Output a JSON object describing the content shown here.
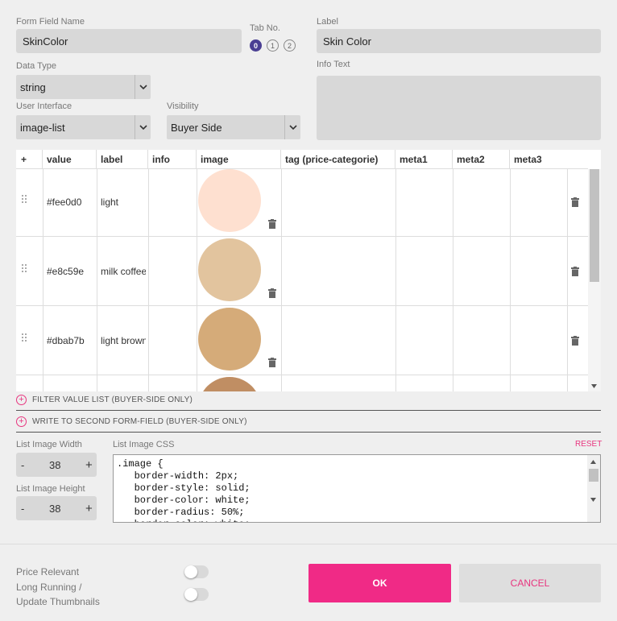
{
  "form": {
    "field_name_label": "Form Field Name",
    "field_name_value": "SkinColor",
    "tab_no_label": "Tab No.",
    "tabs": [
      "0",
      "1",
      "2"
    ],
    "label_label": "Label",
    "label_value": "Skin Color",
    "data_type_label": "Data Type",
    "data_type_value": "string",
    "info_text_label": "Info Text",
    "info_text_value": "",
    "ui_label": "User Interface",
    "ui_value": "image-list",
    "visibility_label": "Visibility",
    "visibility_value": "Buyer Side"
  },
  "table": {
    "add": "+",
    "headers": [
      "value",
      "label",
      "info",
      "image",
      "tag (price-categorie)",
      "meta1",
      "meta2",
      "meta3"
    ],
    "rows": [
      {
        "value": "#fee0d0",
        "label": "light",
        "color": "#fee0d0"
      },
      {
        "value": "#e8c59e",
        "label": "milk coffee",
        "color": "#e2c49e"
      },
      {
        "value": "#dbab7b",
        "label": "light brown",
        "color": "#d5ab79"
      },
      {
        "value": "",
        "label": "",
        "color": "#c08e63"
      }
    ]
  },
  "options": {
    "filter": "FILTER VALUE LIST (BUYER-SIDE ONLY)",
    "write_second": "WRITE TO SECOND FORM-FIELD (BUYER-SIDE ONLY)"
  },
  "image": {
    "width_label": "List Image Width",
    "width_value": "38",
    "height_label": "List Image Height",
    "height_value": "38",
    "minus": "-",
    "plus": "+",
    "css_label": "List Image CSS",
    "reset": "RESET",
    "css_value": ".image {\n   border-width: 2px;\n   border-style: solid;\n   border-color: white;\n   border-radius: 50%;\n   border-color: white;"
  },
  "footer": {
    "price_relevant": "Price Relevant",
    "long_running_1": "Long Running /",
    "long_running_2": "Update Thumbnails",
    "ok": "OK",
    "cancel": "CANCEL"
  },
  "colors": {
    "accent": "#f02a86",
    "tab_active": "#4a3f93",
    "cancel_text": "#e8357f"
  }
}
